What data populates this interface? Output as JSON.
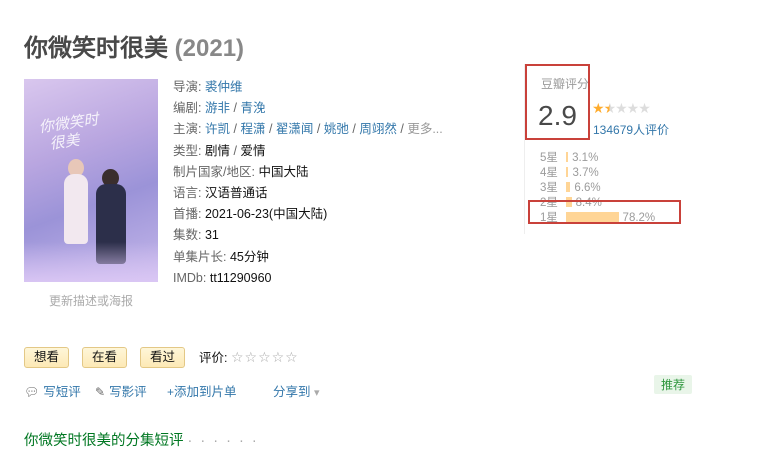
{
  "title": {
    "name": "你微笑时很美",
    "year": "(2021)"
  },
  "poster": {
    "overlay_text": "你微笑时\n很美",
    "edit_link": "更新描述或海报"
  },
  "info": {
    "director_label": "导演",
    "director": "裘仲维",
    "writer_label": "编剧",
    "writers": [
      "游非",
      "青浼"
    ],
    "cast_label": "主演",
    "cast": [
      "许凯",
      "程潇",
      "翟潇闻",
      "姚弛",
      "周翊然"
    ],
    "cast_more": "更多...",
    "genre_label": "类型",
    "genres": [
      "剧情",
      "爱情"
    ],
    "country_label": "制片国家/地区",
    "country": "中国大陆",
    "language_label": "语言",
    "language": "汉语普通话",
    "premiere_label": "首播",
    "premiere": "2021-06-23(中国大陆)",
    "episodes_label": "集数",
    "episodes": "31",
    "runtime_label": "单集片长",
    "runtime": "45分钟",
    "imdb_label": "IMDb",
    "imdb": "tt11290960",
    "colon": ":"
  },
  "rating": {
    "label": "豆瓣评分",
    "score": "2.9",
    "stars_value": 1.5,
    "stars_full": "★",
    "stars_half": "★",
    "stars_empty": "★★★",
    "people": "134679人评价",
    "distribution": [
      {
        "label": "5星",
        "percent_text": "3.1%",
        "percent": 3.1
      },
      {
        "label": "4星",
        "percent_text": "3.7%",
        "percent": 3.7
      },
      {
        "label": "3星",
        "percent_text": "6.6%",
        "percent": 6.6
      },
      {
        "label": "2星",
        "percent_text": "8.4%",
        "percent": 8.4
      },
      {
        "label": "1星",
        "percent_text": "78.2%",
        "percent": 78.2
      }
    ],
    "highlight_color": "#c9413a"
  },
  "actions": {
    "want": "想看",
    "watching": "在看",
    "watched": "看过",
    "rate_label": "评价:",
    "rate_stars": "☆☆☆☆☆"
  },
  "subactions": {
    "short_review": "写短评",
    "review": "写影评",
    "add_list": "添加到片单",
    "share": "分享到",
    "share_caret": "▾",
    "recommend": "推荐"
  },
  "episode_section": {
    "title": "你微笑时很美的分集短评",
    "dots": "· · · · · ·"
  }
}
